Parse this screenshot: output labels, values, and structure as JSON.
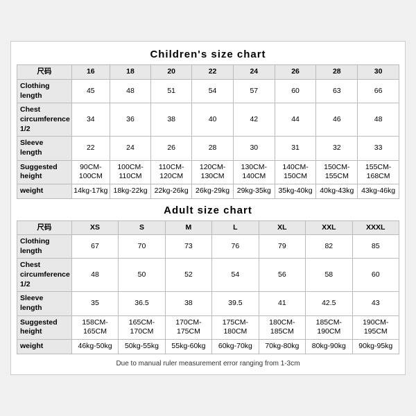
{
  "children_chart": {
    "title": "Children's size chart",
    "columns": [
      "尺码",
      "16",
      "18",
      "20",
      "22",
      "24",
      "26",
      "28",
      "30"
    ],
    "rows": [
      {
        "label": "Clothing\nlength",
        "values": [
          "45",
          "48",
          "51",
          "54",
          "57",
          "60",
          "63",
          "66"
        ]
      },
      {
        "label": "Chest\ncircumference\n1/2",
        "values": [
          "34",
          "36",
          "38",
          "40",
          "42",
          "44",
          "46",
          "48"
        ]
      },
      {
        "label": "Sleeve\nlength",
        "values": [
          "22",
          "24",
          "26",
          "28",
          "30",
          "31",
          "32",
          "33"
        ]
      },
      {
        "label": "Suggested\nheight",
        "values": [
          "90CM-100CM",
          "100CM-110CM",
          "110CM-120CM",
          "120CM-130CM",
          "130CM-140CM",
          "140CM-150CM",
          "150CM-155CM",
          "155CM-168CM"
        ]
      },
      {
        "label": "weight",
        "values": [
          "14kg-17kg",
          "18kg-22kg",
          "22kg-26kg",
          "26kg-29kg",
          "29kg-35kg",
          "35kg-40kg",
          "40kg-43kg",
          "43kg-46kg"
        ]
      }
    ]
  },
  "adult_chart": {
    "title": "Adult size chart",
    "columns": [
      "尺码",
      "XS",
      "S",
      "M",
      "L",
      "XL",
      "XXL",
      "XXXL"
    ],
    "rows": [
      {
        "label": "Clothing\nlength",
        "values": [
          "67",
          "70",
          "73",
          "76",
          "79",
          "82",
          "85"
        ]
      },
      {
        "label": "Chest\ncircumference\n1/2",
        "values": [
          "48",
          "50",
          "52",
          "54",
          "56",
          "58",
          "60"
        ]
      },
      {
        "label": "Sleeve\nlength",
        "values": [
          "35",
          "36.5",
          "38",
          "39.5",
          "41",
          "42.5",
          "43"
        ]
      },
      {
        "label": "Suggested\nheight",
        "values": [
          "158CM-165CM",
          "165CM-170CM",
          "170CM-175CM",
          "175CM-180CM",
          "180CM-185CM",
          "185CM-190CM",
          "190CM-195CM"
        ]
      },
      {
        "label": "weight",
        "values": [
          "46kg-50kg",
          "50kg-55kg",
          "55kg-60kg",
          "60kg-70kg",
          "70kg-80kg",
          "80kg-90kg",
          "90kg-95kg"
        ]
      }
    ]
  },
  "note": "Due to manual ruler measurement error ranging from 1-3cm"
}
